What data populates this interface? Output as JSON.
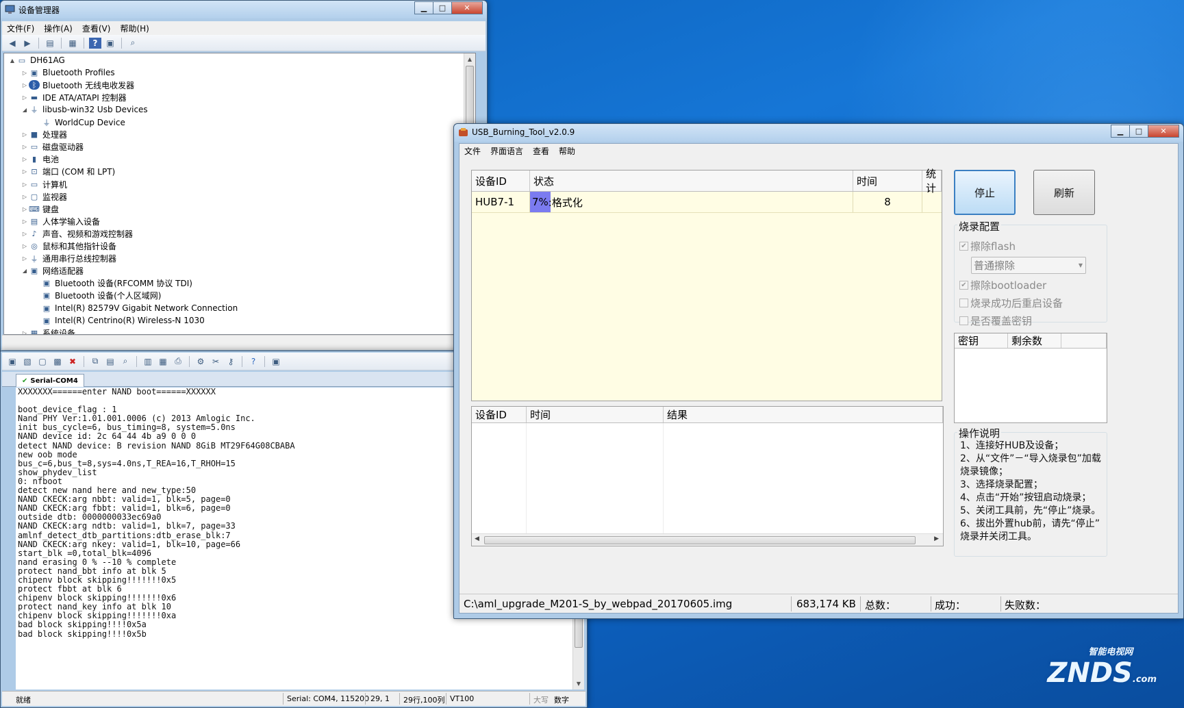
{
  "device_manager": {
    "title": "设备管理器",
    "menu": [
      "文件(F)",
      "操作(A)",
      "查看(V)",
      "帮助(H)"
    ],
    "tree": [
      {
        "label": "DH61AG",
        "level": 0,
        "expander": "▲",
        "icon": "computer-icon"
      },
      {
        "label": "Bluetooth Profiles",
        "level": 1,
        "expander": "▷",
        "icon": "network-icon"
      },
      {
        "label": "Bluetooth 无线电收发器",
        "level": 1,
        "expander": "▷",
        "icon": "bluetooth-icon"
      },
      {
        "label": "IDE ATA/ATAPI 控制器",
        "level": 1,
        "expander": "▷",
        "icon": "ide-icon"
      },
      {
        "label": "libusb-win32 Usb Devices",
        "level": 1,
        "expander": "◢",
        "icon": "usb-icon"
      },
      {
        "label": "WorldCup Device",
        "level": 2,
        "expander": "",
        "icon": "usb-icon"
      },
      {
        "label": "处理器",
        "level": 1,
        "expander": "▷",
        "icon": "cpu-icon"
      },
      {
        "label": "磁盘驱动器",
        "level": 1,
        "expander": "▷",
        "icon": "disk-icon"
      },
      {
        "label": "电池",
        "level": 1,
        "expander": "▷",
        "icon": "battery-icon"
      },
      {
        "label": "端口 (COM 和 LPT)",
        "level": 1,
        "expander": "▷",
        "icon": "port-icon"
      },
      {
        "label": "计算机",
        "level": 1,
        "expander": "▷",
        "icon": "computer-icon"
      },
      {
        "label": "监视器",
        "level": 1,
        "expander": "▷",
        "icon": "monitor-icon"
      },
      {
        "label": "键盘",
        "level": 1,
        "expander": "▷",
        "icon": "keyboard-icon"
      },
      {
        "label": "人体学输入设备",
        "level": 1,
        "expander": "▷",
        "icon": "hid-icon"
      },
      {
        "label": "声音、视频和游戏控制器",
        "level": 1,
        "expander": "▷",
        "icon": "speaker-icon"
      },
      {
        "label": "鼠标和其他指针设备",
        "level": 1,
        "expander": "▷",
        "icon": "mouse-icon"
      },
      {
        "label": "通用串行总线控制器",
        "level": 1,
        "expander": "▷",
        "icon": "usb-icon"
      },
      {
        "label": "网络适配器",
        "level": 1,
        "expander": "◢",
        "icon": "network-icon"
      },
      {
        "label": "Bluetooth 设备(RFCOMM 协议 TDI)",
        "level": 2,
        "expander": "",
        "icon": "network-icon"
      },
      {
        "label": "Bluetooth 设备(个人区域网)",
        "level": 2,
        "expander": "",
        "icon": "network-icon"
      },
      {
        "label": "Intel(R) 82579V Gigabit Network Connection",
        "level": 2,
        "expander": "",
        "icon": "network-icon"
      },
      {
        "label": "Intel(R) Centrino(R) Wireless-N 1030",
        "level": 2,
        "expander": "",
        "icon": "network-icon"
      },
      {
        "label": "系统设备",
        "level": 1,
        "expander": "▷",
        "icon": "system-icon"
      }
    ]
  },
  "serial": {
    "tab": "Serial-COM4",
    "lines": [
      "XXXXXXX======enter NAND boot======XXXXXX",
      "",
      "boot_device_flag : 1",
      "Nand PHY Ver:1.01.001.0006 (c) 2013 Amlogic Inc.",
      "init bus_cycle=6, bus_timing=8, system=5.0ns",
      "NAND device id: 2c 64 44 4b a9 0 0 0",
      "detect NAND device: B revision NAND 8GiB MT29F64G08CBABA",
      "new oob mode",
      "bus_c=6,bus_t=8,sys=4.0ns,T_REA=16,T_RHOH=15",
      "show_phydev_list",
      "0: nfboot",
      "detect new nand here and new_type:50",
      "NAND CKECK:arg nbbt: valid=1, blk=5, page=0",
      "NAND CKECK:arg fbbt: valid=1, blk=6, page=0",
      "outside dtb: 0000000033ec69a0",
      "NAND CKECK:arg ndtb: valid=1, blk=7, page=33",
      "amlnf_detect_dtb_partitions:dtb_erase_blk:7",
      "NAND CKECK:arg nkey: valid=1, blk=10, page=66",
      "start_blk =0,total_blk=4096",
      "nand erasing 0 % --10 % complete",
      "protect nand_bbt info at blk 5",
      "chipenv block skipping!!!!!!!0x5",
      "protect fbbt at blk 6",
      "chipenv block skipping!!!!!!!0x6",
      "protect nand_key info at blk 10",
      "chipenv block skipping!!!!!!!0xa",
      "bad block skipping!!!!0x5a",
      "bad block skipping!!!!0x5b"
    ],
    "status": {
      "ready": "就绪",
      "port": "Serial: COM4, 115200",
      "pos": "29,  1",
      "size": "29行,100列",
      "term": "VT100",
      "caps": "大写",
      "num": "数字"
    }
  },
  "burn_tool": {
    "title": "USB_Burning_Tool_v2.0.9",
    "menu": [
      "文件",
      "界面语言",
      "查看",
      "帮助"
    ],
    "device_table": {
      "headers": [
        "设备ID",
        "状态",
        "时间",
        "统计"
      ],
      "rows": [
        {
          "id": "HUB7-1",
          "progress_pct": "7%",
          "progress_fraction": 0.07,
          "status": ":格式化",
          "time": "8",
          "stat": ""
        }
      ]
    },
    "buttons": {
      "stop": "停止",
      "refresh": "刷新"
    },
    "config": {
      "title": "烧录配置",
      "erase_flash": "擦除flash",
      "erase_mode": "普通擦除",
      "erase_bootloader": "擦除bootloader",
      "reboot_after": "烧录成功后重启设备",
      "overwrite_key": "是否覆盖密钥"
    },
    "key_table": {
      "headers": [
        "密钥",
        "剩余数"
      ]
    },
    "result_table": {
      "headers": [
        "设备ID",
        "时间",
        "结果"
      ]
    },
    "instructions": {
      "title": "操作说明",
      "lines": [
        "1、连接好HUB及设备；",
        "2、从“文件”－“导入烧录包”加载",
        "烧录镜像；",
        "3、选择烧录配置；",
        "4、点击“开始”按钮启动烧录；",
        "5、关闭工具前，先“停止”烧录。",
        "6、拔出外置hub前，请先“停止”",
        "烧录并关闭工具。"
      ]
    },
    "status_bar": {
      "path": "C:\\aml_upgrade_M201-S_by_webpad_20170605.img",
      "size": "683,174 KB",
      "total": "总数：",
      "success": "成功：",
      "fail": "失败数："
    },
    "colors": {
      "progress": "#7b7bf0",
      "table_bg": "#fffde4"
    }
  },
  "watermark": {
    "top": "智能电视网",
    "main": "ZNDS",
    "suffix": ".com"
  }
}
